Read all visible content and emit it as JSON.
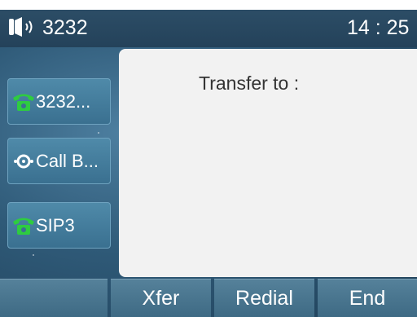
{
  "status_bar": {
    "account": "3232",
    "time": "14 : 25",
    "icon": "speaker-icon"
  },
  "line_keys": [
    {
      "label": "3232...",
      "icon": "phone-icon",
      "icon_color": "#2ecc40"
    },
    {
      "label": "Call B...",
      "icon": "circle-dot-icon",
      "icon_color": "#ffffff"
    },
    {
      "label": "SIP3",
      "icon": "phone-icon",
      "icon_color": "#2ecc40"
    }
  ],
  "dialog": {
    "title": "Transfer to :"
  },
  "softkeys": [
    "",
    "Xfer",
    "Redial",
    "End"
  ]
}
